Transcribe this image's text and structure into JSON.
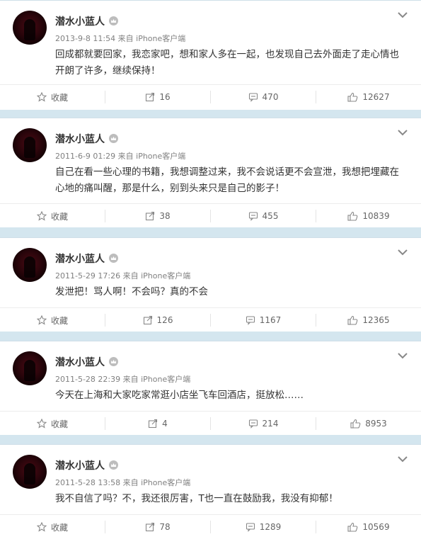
{
  "posts": [
    {
      "user": "潜水小蓝人",
      "time": "2013-9-8 11:54",
      "source": "来自 iPhone客户端",
      "text": "回成都就要回家，我恋家吧，想和家人多在一起，也发现自己去外面走了走心情也开朗了许多，继续保持！",
      "favorite": "收藏",
      "reposts": "16",
      "comments": "470",
      "likes": "12627"
    },
    {
      "user": "潜水小蓝人",
      "time": "2011-6-9 01:29",
      "source": "来自 iPhone客户端",
      "text": "自己在看一些心理的书籍，我想调整过来，我不会说话更不会宣泄，我想把埋藏在心地的痛叫醒，那是什么，别到头来只是自己的影子！",
      "favorite": "收藏",
      "reposts": "38",
      "comments": "455",
      "likes": "10839"
    },
    {
      "user": "潜水小蓝人",
      "time": "2011-5-29 17:26",
      "source": "来自 iPhone客户端",
      "text": "发泄把！骂人啊！不会吗？真的不会",
      "favorite": "收藏",
      "reposts": "126",
      "comments": "1167",
      "likes": "12365"
    },
    {
      "user": "潜水小蓝人",
      "time": "2011-5-28 22:39",
      "source": "来自 iPhone客户端",
      "text": "今天在上海和大家吃家常逛小店坐飞车回酒店，挺放松……",
      "favorite": "收藏",
      "reposts": "4",
      "comments": "214",
      "likes": "8953"
    },
    {
      "user": "潜水小蓝人",
      "time": "2011-5-28 13:58",
      "source": "来自 iPhone客户端",
      "text": "我不自信了吗？不，我还很厉害，T也一直在鼓励我，我没有抑郁！",
      "favorite": "收藏",
      "reposts": "78",
      "comments": "1289",
      "likes": "10569"
    }
  ]
}
